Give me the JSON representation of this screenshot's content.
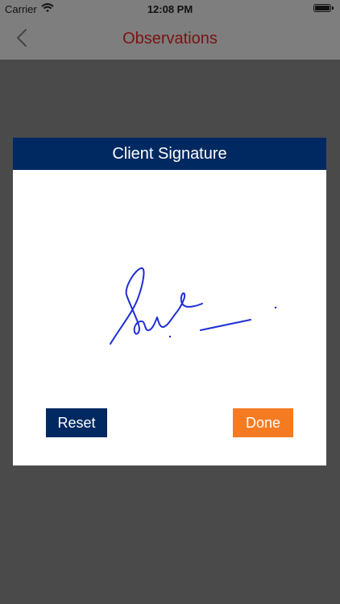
{
  "status_bar": {
    "carrier": "Carrier",
    "time": "12:08 PM"
  },
  "nav": {
    "title": "Observations",
    "back_icon": "chevron-left-icon"
  },
  "dialog": {
    "title": "Client Signature",
    "reset_label": "Reset",
    "done_label": "Done"
  },
  "colors": {
    "header_bg": "#002962",
    "reset_bg": "#002962",
    "done_bg": "#f57b23",
    "title_text": "#7a1212",
    "signature_ink": "#1f2ed6",
    "overlay": "#4a4a4a"
  }
}
